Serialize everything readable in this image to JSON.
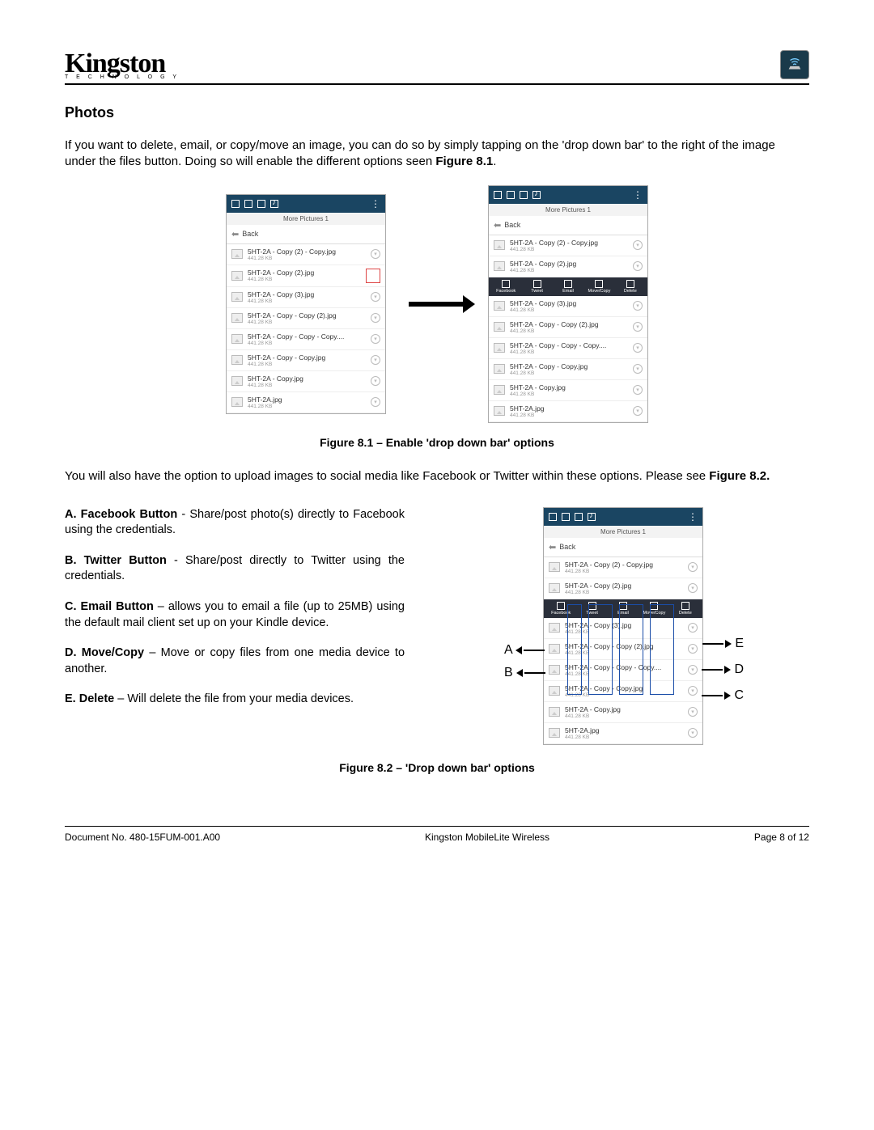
{
  "header": {
    "logo_main": "Kingston",
    "logo_sub": "T E C H N O L O G Y"
  },
  "section_title": "Photos",
  "intro_para": "If you want to delete, email, or copy/move an image, you can do so by simply tapping on the 'drop down bar' to the right of the image under the files button.  Doing so will enable the different options seen ",
  "intro_fig_ref": "Figure 8.1",
  "fig1_caption": "Figure 8.1 – Enable 'drop down bar' options",
  "para2_a": "You will also have the option to upload images to social media like Facebook or Twitter within these options. Please see ",
  "para2_b": "Figure 8.2.",
  "options": {
    "A": {
      "title": "A.  Facebook Button",
      "desc": " - Share/post photo(s) directly to Facebook using the credentials."
    },
    "B": {
      "title": "B.  Twitter Button",
      "desc": " - Share/post directly to Twitter using the credentials."
    },
    "C": {
      "title": "C.  Email Button",
      "desc": " – allows you to email a file (up to 25MB) using the default mail client set up on your Kindle device."
    },
    "D": {
      "title": "D.  Move/Copy",
      "desc": " – Move or copy files from one media device to another."
    },
    "E": {
      "title": "E.  Delete",
      "desc": " – Will delete the file from your media devices."
    }
  },
  "fig2_caption": "Figure 8.2 – 'Drop down bar' options",
  "phone": {
    "title_strip": "More Pictures 1",
    "back_label": "Back",
    "files": [
      {
        "name": "5HT-2A - Copy (2) - Copy.jpg",
        "size": "441.28 KB"
      },
      {
        "name": "5HT-2A - Copy (2).jpg",
        "size": "441.28 KB"
      },
      {
        "name": "5HT-2A - Copy (3).jpg",
        "size": "441.28 KB"
      },
      {
        "name": "5HT-2A - Copy - Copy (2).jpg",
        "size": "441.28 KB"
      },
      {
        "name": "5HT-2A - Copy - Copy - Copy....",
        "size": "441.28 KB"
      },
      {
        "name": "5HT-2A - Copy - Copy.jpg",
        "size": "441.28 KB"
      },
      {
        "name": "5HT-2A - Copy.jpg",
        "size": "441.28 KB"
      },
      {
        "name": "5HT-2A.jpg",
        "size": "441.28 KB"
      }
    ],
    "actions": [
      "Facebook",
      "Tweet",
      "Email",
      "Move/Copy",
      "Delete"
    ]
  },
  "annot": {
    "A": "A",
    "B": "B",
    "C": "C",
    "D": "D",
    "E": "E"
  },
  "footer": {
    "doc_no": "Document No. 480-15FUM-001.A00",
    "center": "Kingston MobileLite Wireless",
    "page": "Page 8 of 12"
  }
}
